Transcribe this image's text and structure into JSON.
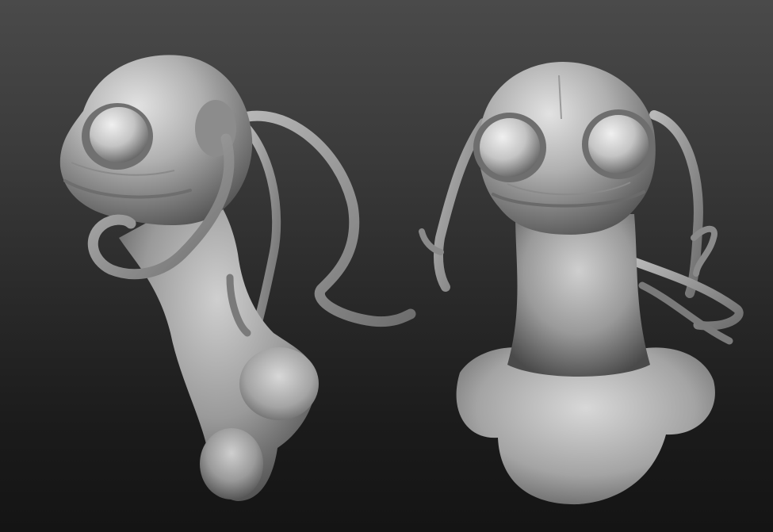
{
  "viewport": {
    "background_top": "#4a4a4a",
    "background_bottom": "#141414"
  },
  "material": {
    "clay_light": "#e2e2e2",
    "clay_mid": "#a6a6a6",
    "clay_dark": "#555555",
    "eye_light": "#ececec"
  },
  "models": [
    {
      "name": "alien-bust-three-quarter-view"
    },
    {
      "name": "alien-bust-front-view"
    }
  ]
}
